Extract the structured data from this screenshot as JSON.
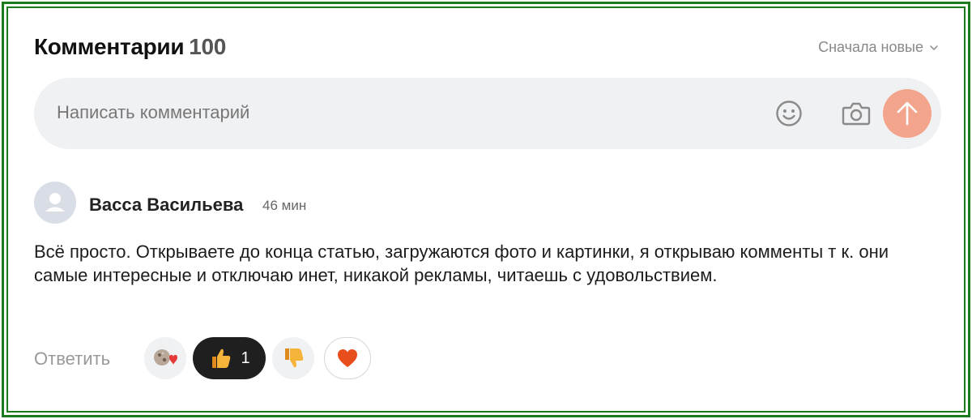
{
  "header": {
    "title": "Комментарии",
    "count": "100",
    "sort_label": "Сначала новые"
  },
  "composer": {
    "placeholder": "Написать комментарий",
    "emoji_icon": "smile-icon",
    "camera_icon": "camera-icon",
    "send_icon": "arrow-up-icon",
    "send_color": "#f3a48c"
  },
  "comment": {
    "author": "Васса Васильева",
    "time": "46 мин",
    "text": "Всё просто. Открываете до конца статью, загружаются фото и картинки, я открываю комменты т к. они самые интересные и отключаю инет, никакой рекламы, читаешь с удовольствием.",
    "reply_label": "Ответить",
    "reactions": [
      {
        "icon": "reaction-stack-icon",
        "count": ""
      },
      {
        "icon": "thumbs-up-icon",
        "count": "1",
        "active": true
      },
      {
        "icon": "thumbs-down-icon",
        "count": ""
      },
      {
        "icon": "heart-icon",
        "count": ""
      }
    ]
  },
  "colors": {
    "frame": "#1b7a1b",
    "accent": "#f3a48c",
    "chip_bg": "#f0f1f3",
    "active_chip": "#1f1f1f"
  }
}
